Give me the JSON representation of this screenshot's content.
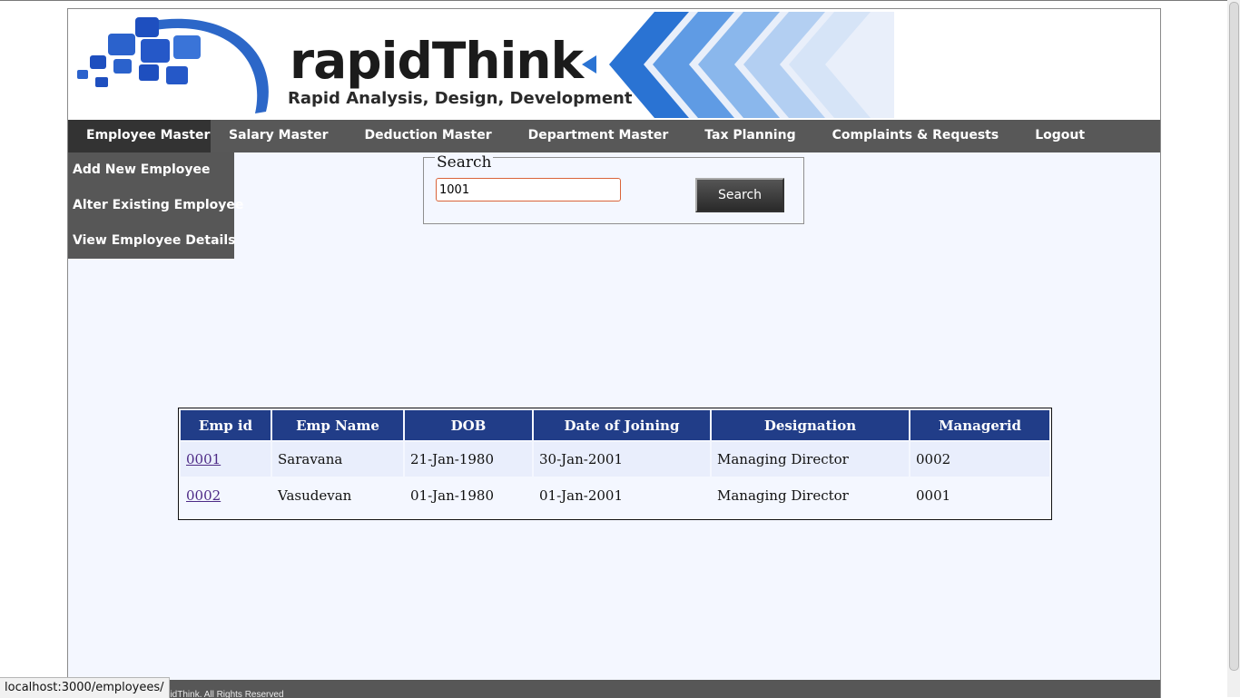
{
  "brand": {
    "name": "rapidThink",
    "tagline": "Rapid Analysis, Design, Development",
    "colors": {
      "nav": "#585858",
      "active": "#333333",
      "table_header": "#213d88",
      "logo_blue": "#2c67c8"
    }
  },
  "nav": {
    "items": [
      {
        "label": "Employee Master",
        "active": true
      },
      {
        "label": "Salary Master"
      },
      {
        "label": "Deduction Master"
      },
      {
        "label": "Department Master"
      },
      {
        "label": "Tax Planning"
      },
      {
        "label": "Complaints & Requests"
      },
      {
        "label": "Logout"
      }
    ]
  },
  "submenu": {
    "items": [
      {
        "label": "Add New Employee"
      },
      {
        "label": "Alter Existing Employee"
      },
      {
        "label": "View Employee Details"
      }
    ]
  },
  "search": {
    "legend": "Search",
    "value": "1001",
    "button_label": "Search"
  },
  "table": {
    "headers": [
      "Emp id",
      "Emp Name",
      "DOB",
      "Date of Joining",
      "Designation",
      "Managerid"
    ],
    "rows": [
      [
        "0001",
        "Saravana",
        "21-Jan-1980",
        "30-Jan-2001",
        "Managing Director",
        "0002"
      ],
      [
        "0002",
        "Vasudevan",
        "01-Jan-1980",
        "01-Jan-2001",
        "Managing Director",
        "0001"
      ]
    ]
  },
  "footer": {
    "text": "rapidThink. All Rights Reserved"
  },
  "status_bar": {
    "url": "localhost:3000/employees/"
  }
}
